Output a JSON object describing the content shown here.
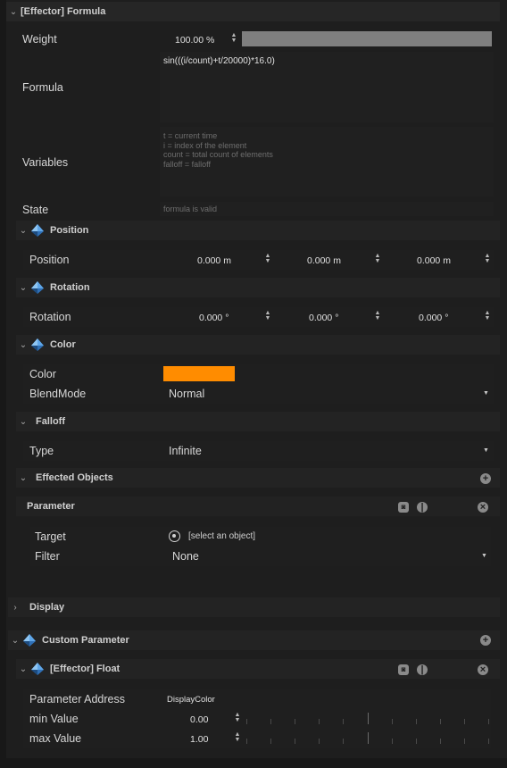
{
  "effector_formula": {
    "title": "[Effector] Formula",
    "weight_label": "Weight",
    "weight_value": "100.00 %",
    "weight_fraction": 1.0,
    "formula_label": "Formula",
    "formula_value": "sin(((i/count)+t/20000)*16.0)",
    "variables_label": "Variables",
    "variables_lines": [
      "t = current time",
      "i = index of the element",
      "count = total count of elements",
      "falloff = falloff"
    ],
    "state_label": "State",
    "state_value": "formula is valid"
  },
  "position": {
    "title": "Position",
    "label": "Position",
    "values": [
      "0.000 m",
      "0.000 m",
      "0.000 m"
    ]
  },
  "rotation": {
    "title": "Rotation",
    "label": "Rotation",
    "values": [
      "0.000 °",
      "0.000 °",
      "0.000 °"
    ]
  },
  "color": {
    "title": "Color",
    "label": "Color",
    "swatch": "#ff8c00",
    "blend_label": "BlendMode",
    "blend_value": "Normal"
  },
  "falloff": {
    "title": "Falloff",
    "type_label": "Type",
    "type_value": "Infinite"
  },
  "effected_objects": {
    "title": "Effected Objects",
    "parameter_title": "Parameter",
    "target_label": "Target",
    "target_value": "[select an object]",
    "filter_label": "Filter",
    "filter_value": "None"
  },
  "display": {
    "title": "Display"
  },
  "custom_parameter": {
    "title": "Custom Parameter",
    "float_title": "[Effector] Float",
    "address_label": "Parameter Address",
    "address_value": "DisplayColor",
    "min_label": "min Value",
    "min_value": "0.00",
    "max_label": "max Value",
    "max_value": "1.00"
  },
  "colors": {
    "accent": "#ff8c00",
    "bg": "#1e1e1e",
    "header_bg": "#232323",
    "field_bg": "#202020"
  }
}
